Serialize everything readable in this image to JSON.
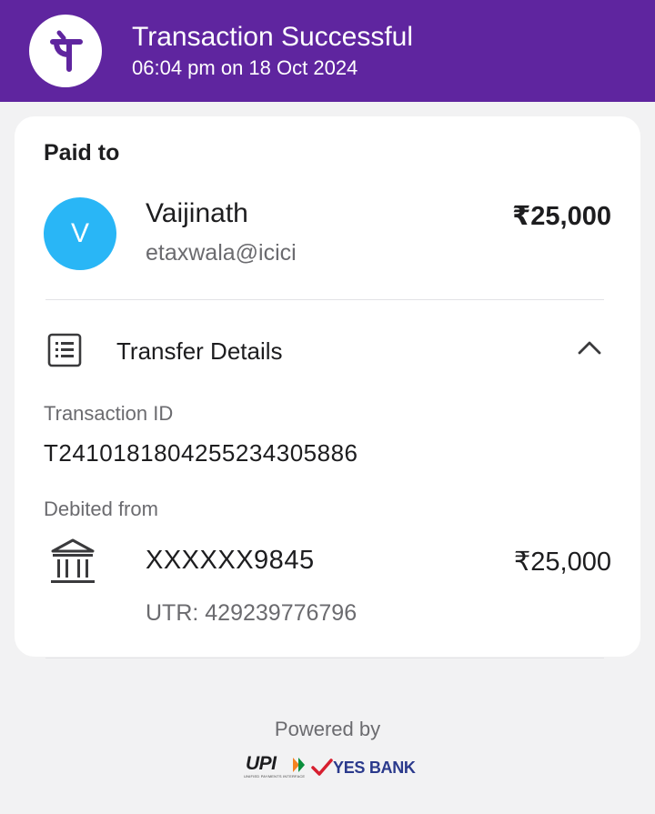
{
  "colors": {
    "header_bg": "#5f259f",
    "avatar_bg": "#29b6f6",
    "card_bg": "#ffffff",
    "page_bg": "#f2f2f3"
  },
  "header": {
    "logo_icon": "phonepe-logo",
    "title": "Transaction Successful",
    "datetime": "06:04 pm on 18 Oct 2024"
  },
  "card": {
    "paid_to_label": "Paid to",
    "payee": {
      "avatar_letter": "V",
      "name": "Vaijinath",
      "upi_id": "etaxwala@icici",
      "amount": "₹25,000"
    },
    "transfer_details": {
      "icon": "receipt-list-icon",
      "label": "Transfer Details",
      "expanded": true,
      "transaction_id_label": "Transaction ID",
      "transaction_id": "T2410181804255234305886",
      "debited_from_label": "Debited from",
      "bank_icon": "bank-icon",
      "account": "XXXXXX9845",
      "amount": "₹25,000",
      "utr": "UTR: 429239776796"
    }
  },
  "footer": {
    "powered_by": "Powered by",
    "upi_logo_text": "UPI",
    "upi_tagline": "UNIFIED PAYMENTS INTERFACE",
    "bank_logo_text": "YES BANK"
  }
}
